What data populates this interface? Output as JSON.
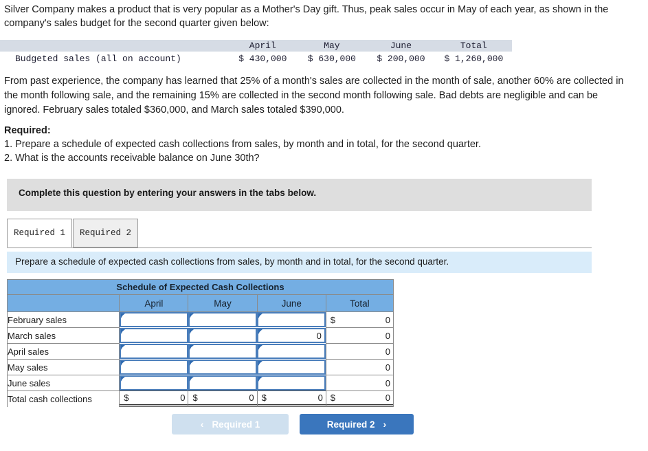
{
  "intro": {
    "paragraph": "Silver Company makes a product that is very popular as a Mother's Day gift. Thus, peak sales occur in May of each year, as shown in the company's sales budget for the second quarter given below:"
  },
  "budget_table": {
    "columns": [
      "",
      "April",
      "May",
      "June",
      "Total"
    ],
    "rows": [
      {
        "label": "Budgeted sales (all on account)",
        "april": "$ 430,000",
        "may": "$ 630,000",
        "june": "$ 200,000",
        "total": "$ 1,260,000"
      }
    ]
  },
  "paragraph2": "From past experience, the company has learned that 25% of a month's sales are collected in the month of sale, another 60% are collected in the month following sale, and the remaining 15% are collected in the second month following sale. Bad debts are negligible and can be ignored. February sales totaled $360,000, and March sales totaled $390,000.",
  "required": {
    "heading": "Required:",
    "item1": "1. Prepare a schedule of expected cash collections from sales, by month and in total, for the second quarter.",
    "item2": "2. What is the accounts receivable balance on June 30th?"
  },
  "gray_panel": {
    "text": "Complete this question by entering your answers in the tabs below."
  },
  "tabs": [
    {
      "label": "Required 1",
      "active": true
    },
    {
      "label": "Required 2",
      "active": false
    }
  ],
  "info_bar": {
    "text": "Prepare a schedule of expected cash collections from sales, by month and in total, for the second quarter."
  },
  "schedule": {
    "title": "Schedule of Expected Cash Collections",
    "columns": [
      "",
      "April",
      "May",
      "June",
      "Total"
    ],
    "rows": [
      {
        "label": "February sales",
        "april": "",
        "may": "",
        "june": "",
        "total_currency": "$",
        "total": "0"
      },
      {
        "label": "March sales",
        "april": "",
        "may": "",
        "june": "0",
        "total_currency": "",
        "total": "0"
      },
      {
        "label": "April sales",
        "april": "",
        "may": "",
        "june": "",
        "total_currency": "",
        "total": "0"
      },
      {
        "label": "May sales",
        "april": "",
        "may": "",
        "june": "",
        "total_currency": "",
        "total": "0"
      },
      {
        "label": "June sales",
        "april": "",
        "may": "",
        "june": "",
        "total_currency": "",
        "total": "0"
      }
    ],
    "total_row": {
      "label": "Total cash collections",
      "april_currency": "$",
      "april": "0",
      "may_currency": "$",
      "may": "0",
      "june_currency": "$",
      "june": "0",
      "total_currency": "$",
      "total": "0"
    }
  },
  "nav": {
    "prev_label": "Required 1",
    "prev_chevron": "‹",
    "next_label": "Required 2",
    "next_chevron": "›"
  },
  "colors": {
    "header_blue": "#74aee3",
    "info_blue": "#d9ecfa",
    "gray_panel": "#dedede",
    "budget_header_gray": "#d6dce5",
    "input_border": "#4a7ebb",
    "btn_primary": "#3a76bd",
    "btn_disabled": "#cfe0ef"
  }
}
